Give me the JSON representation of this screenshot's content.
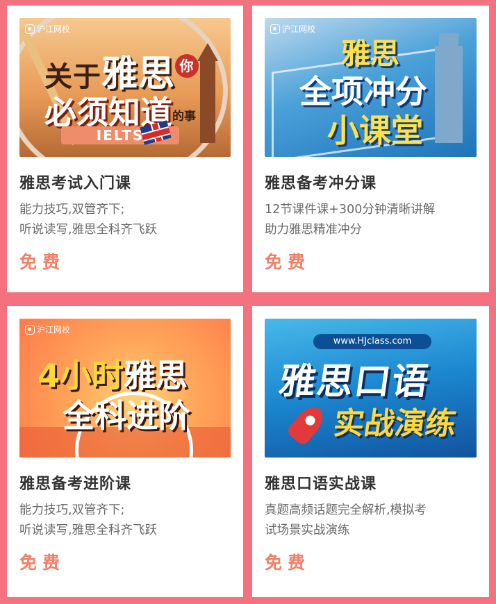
{
  "brand": "沪江网校",
  "courses": [
    {
      "banner": {
        "line1_pre": "关于",
        "line1_big": "雅思",
        "line1_circle": "你",
        "line2": "必须知道",
        "line2_small": "的事",
        "tag": "IELTS"
      },
      "title": "雅思考试入门课",
      "desc_lines": [
        "能力技巧,双管齐下;",
        "听说读写,雅思全科齐飞跃"
      ],
      "price": "免费"
    },
    {
      "banner": {
        "line1": "雅思",
        "line2": "全项冲分",
        "line3": "小课堂"
      },
      "title": "雅思备考冲分课",
      "desc_lines": [
        "12节课件课+300分钟清晰讲解",
        "助力雅思精准冲分"
      ],
      "price": "免费"
    },
    {
      "banner": {
        "line1_num": "4小时",
        "line1_text": "雅思",
        "line2": "全科进阶"
      },
      "title": "雅思备考进阶课",
      "desc_lines": [
        "能力技巧,双管齐下;",
        "听说读写,雅思全科齐飞跃"
      ],
      "price": "免费"
    },
    {
      "banner": {
        "url": "www.HJclass.com",
        "line1": "雅思口语",
        "line2": "实战演练"
      },
      "title": "雅思口语实战课",
      "desc_lines": [
        "真题高频话题完全解析,模拟考",
        "试场景实战演练"
      ],
      "price": "免费"
    }
  ]
}
